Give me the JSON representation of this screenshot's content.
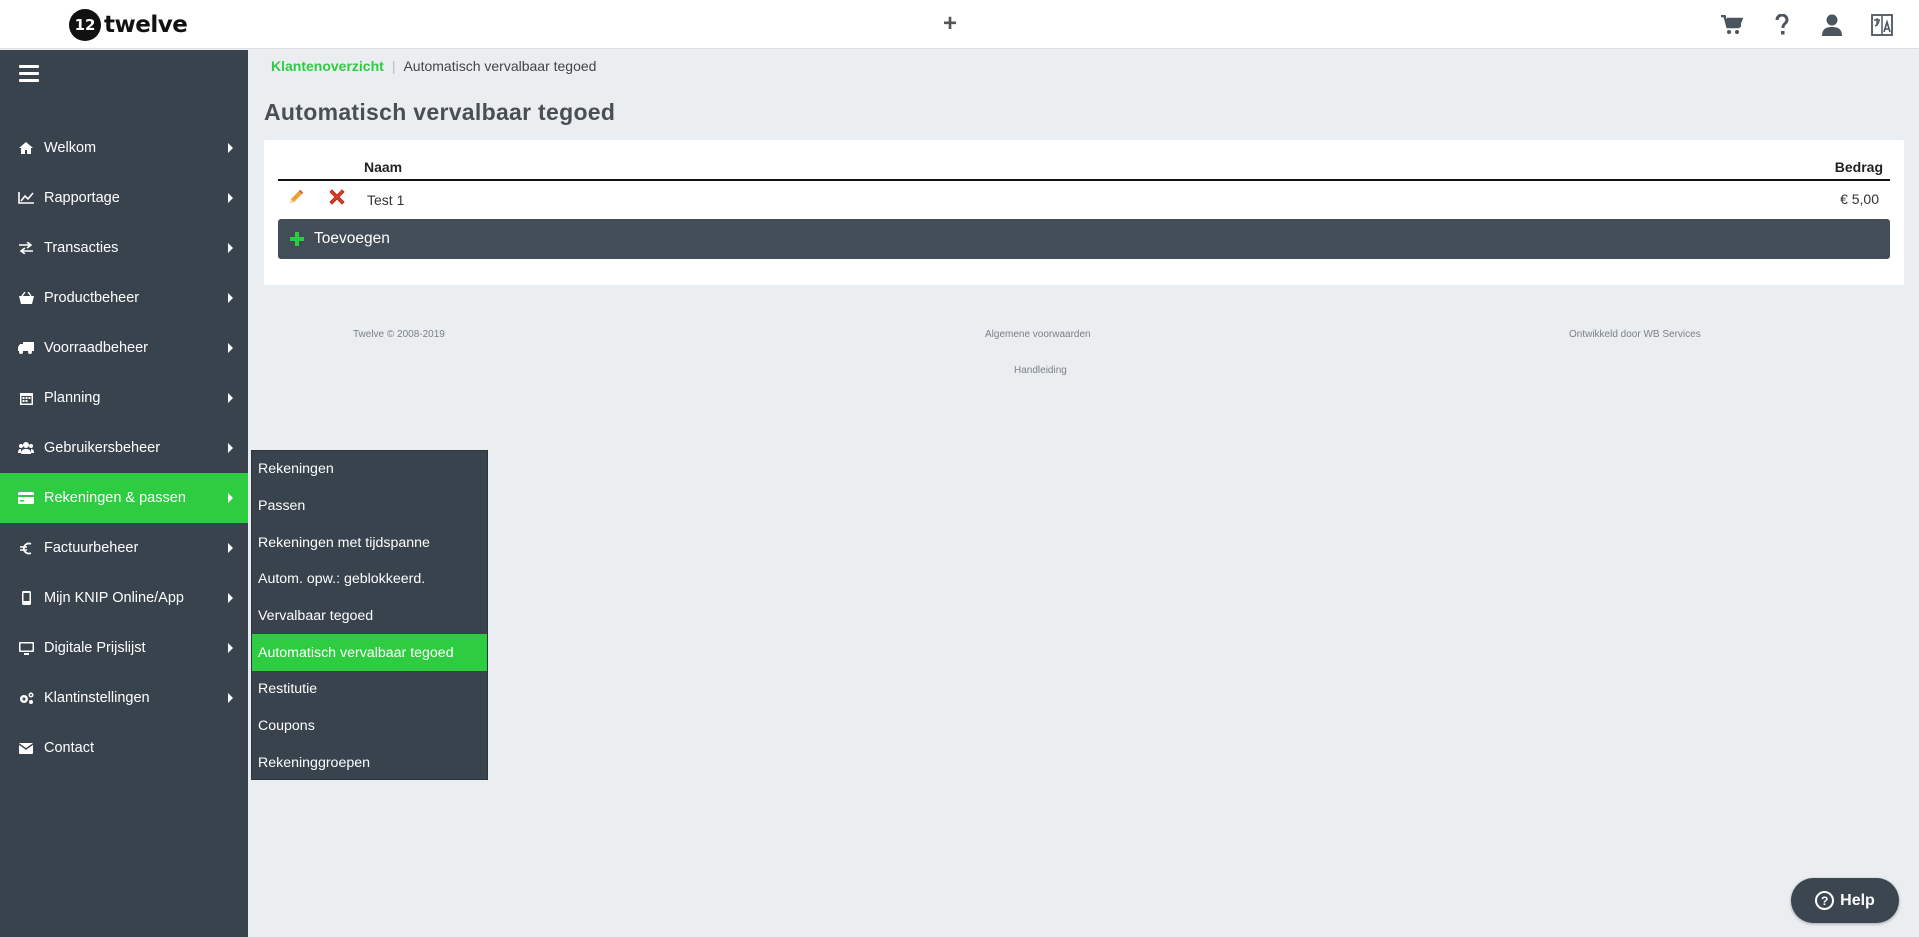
{
  "app": {
    "logo_mark": "12",
    "logo_text": "twelve"
  },
  "topbar": {
    "plus_label": "+"
  },
  "sidebar": {
    "items": [
      {
        "label": "Welkom",
        "icon": "home-icon"
      },
      {
        "label": "Rapportage",
        "icon": "chart-icon"
      },
      {
        "label": "Transacties",
        "icon": "exchange-icon"
      },
      {
        "label": "Productbeheer",
        "icon": "basket-icon"
      },
      {
        "label": "Voorraadbeheer",
        "icon": "truck-icon"
      },
      {
        "label": "Planning",
        "icon": "calendar-icon"
      },
      {
        "label": "Gebruikersbeheer",
        "icon": "users-icon"
      },
      {
        "label": "Rekeningen & passen",
        "icon": "credit-card-icon",
        "active": true
      },
      {
        "label": "Factuurbeheer",
        "icon": "euro-icon"
      },
      {
        "label": "Mijn KNIP Online/App",
        "icon": "mobile-icon"
      },
      {
        "label": "Digitale Prijslijst",
        "icon": "monitor-icon"
      },
      {
        "label": "Klantinstellingen",
        "icon": "cogs-icon"
      },
      {
        "label": "Contact",
        "icon": "envelope-icon"
      }
    ]
  },
  "submenu": {
    "items": [
      "Rekeningen",
      "Passen",
      "Rekeningen met tijdspanne",
      "Autom. opw.: geblokkeerd.",
      "Vervalbaar tegoed",
      "Automatisch vervalbaar tegoed",
      "Restitutie",
      "Coupons",
      "Rekeninggroepen"
    ],
    "active_index": 5
  },
  "breadcrumb": {
    "root": "Klantenoverzicht",
    "separator": "|",
    "current": "Automatisch vervalbaar tegoed"
  },
  "page": {
    "title": "Automatisch vervalbaar tegoed"
  },
  "table": {
    "headers": {
      "name": "Naam",
      "amount": "Bedrag"
    },
    "rows": [
      {
        "name": "Test 1",
        "amount": "€ 5,00"
      }
    ],
    "add_label": "Toevoegen"
  },
  "footer": {
    "copyright": "Twelve © 2008-2019",
    "terms": "Algemene voorwaarden",
    "developer": "Ontwikkeld door WB Services",
    "manual": "Handleiding"
  },
  "help": {
    "label": "Help",
    "glyph": "?"
  },
  "colors": {
    "accent": "#2ecc40",
    "sidebar": "#39434d",
    "background": "#ebeef1"
  }
}
